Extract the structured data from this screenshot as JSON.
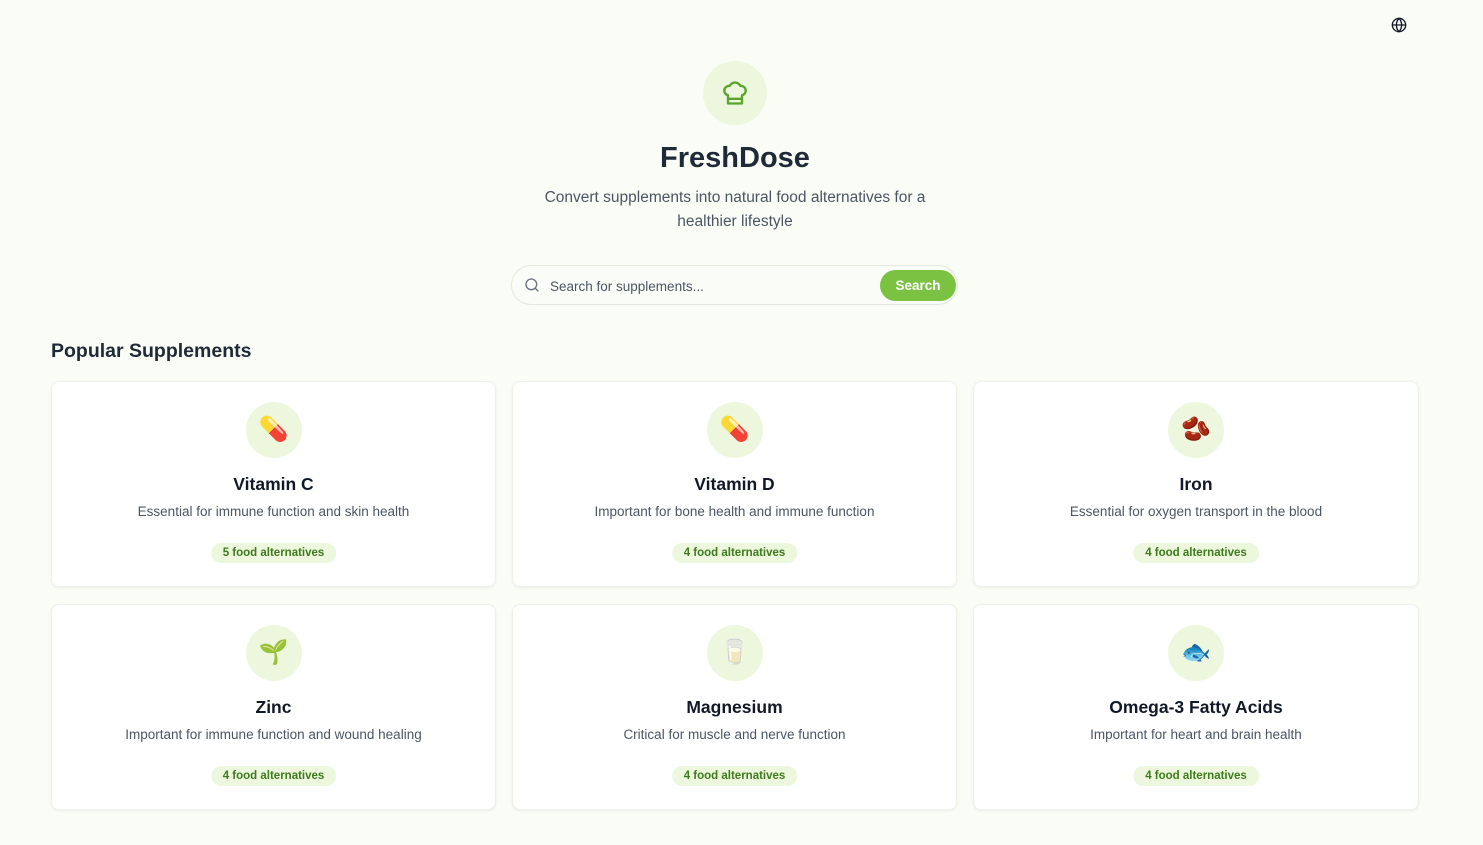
{
  "app": {
    "title": "FreshDose",
    "subtitle": "Convert supplements into natural food alternatives for a healthier lifestyle"
  },
  "header": {
    "language_icon": "globe-icon",
    "hero_icon": "chef-hat-icon"
  },
  "search": {
    "placeholder": "Search for supplements...",
    "value": "",
    "button_label": "Search",
    "icon": "search-icon"
  },
  "section": {
    "title": "Popular Supplements"
  },
  "colors": {
    "accent": "#7cc242",
    "accent_soft": "#ecf7dd",
    "badge_text": "#3f7a1e",
    "background": "#f9fdf5"
  },
  "supplements": [
    {
      "name": "Vitamin C",
      "description": "Essential for immune function and skin health",
      "badge": "5 food alternatives",
      "icon": "pill-icon",
      "glyph": "💊"
    },
    {
      "name": "Vitamin D",
      "description": "Important for bone health and immune function",
      "badge": "4 food alternatives",
      "icon": "pill-icon",
      "glyph": "💊"
    },
    {
      "name": "Iron",
      "description": "Essential for oxygen transport in the blood",
      "badge": "4 food alternatives",
      "icon": "beans-icon",
      "glyph": "🫘"
    },
    {
      "name": "Zinc",
      "description": "Important for immune function and wound healing",
      "badge": "4 food alternatives",
      "icon": "seedling-icon",
      "glyph": "🌱"
    },
    {
      "name": "Magnesium",
      "description": "Critical for muscle and nerve function",
      "badge": "4 food alternatives",
      "icon": "glass-icon",
      "glyph": "🥛"
    },
    {
      "name": "Omega-3 Fatty Acids",
      "description": "Important for heart and brain health",
      "badge": "4 food alternatives",
      "icon": "fish-icon",
      "glyph": "🐟"
    }
  ]
}
